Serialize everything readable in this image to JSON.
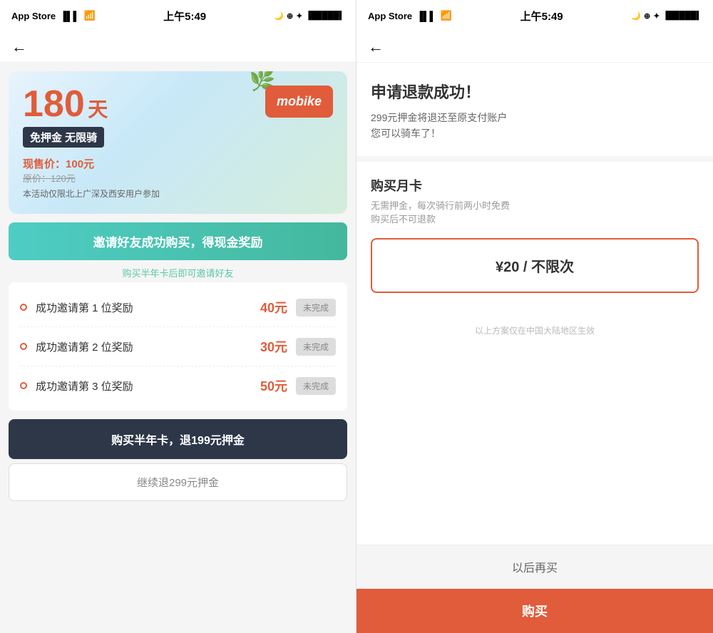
{
  "left": {
    "statusBar": {
      "appName": "App Store",
      "time": "上午5:49",
      "signal": "●●●",
      "wifi": "WiFi",
      "battery": "■■■■"
    },
    "navBar": {
      "backArrow": "←"
    },
    "banner": {
      "days": "180",
      "dayUnit": "天",
      "badge": "免押金 无限骑",
      "currentPriceLabel": "现售价：",
      "currentPrice": "100元",
      "originalPriceLabel": "原价：120元",
      "note": "本活动仅限北上广深及西安用户参加",
      "logoText": "mobike"
    },
    "inviteBanner": {
      "text": "邀请好友成功购买，得现金奖励"
    },
    "inviteSub": "购买半年卡后即可邀请好友",
    "rewards": [
      {
        "label": "成功邀请第 1 位奖励",
        "amount": "40元",
        "status": "未完成"
      },
      {
        "label": "成功邀请第 2 位奖励",
        "amount": "30元",
        "status": "未完成"
      },
      {
        "label": "成功邀请第 3 位奖励",
        "amount": "50元",
        "status": "未完成"
      }
    ],
    "btnPrimary": "购买半年卡，退199元押金",
    "btnSecondary": "继续退299元押金"
  },
  "right": {
    "statusBar": {
      "appName": "App Store",
      "time": "上午5:49",
      "signal": "●●●",
      "wifi": "WiFi",
      "battery": "■■■■"
    },
    "navBar": {
      "backArrow": "←"
    },
    "successTitle": "申请退款成功！",
    "successDesc": "299元押金将退还至原支付账户\n您可以骑车了！",
    "monthlyTitle": "购买月卡",
    "monthlyDesc": "无需押金，每次骑行前两小时免费\n购买后不可退款",
    "priceCardText": "¥20 / 不限次",
    "regionNote": "以上方案仅在中国大陆地区生效",
    "btnLater": "以后再买",
    "btnBuy": "购买"
  }
}
